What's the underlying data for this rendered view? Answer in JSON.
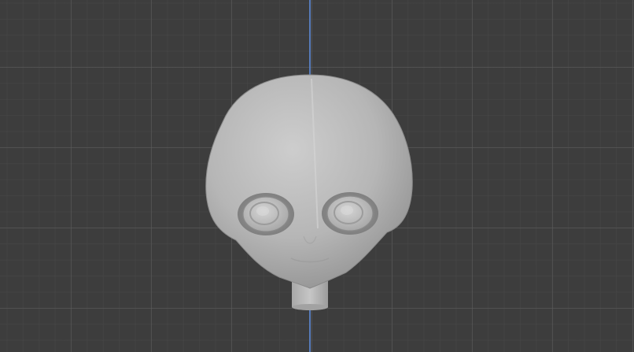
{
  "viewport": {
    "background_color": "#3d3d3d",
    "grid_minor_color": "#484848",
    "grid_major_color": "#5c5c5c",
    "z_axis_color": "#5a82c8"
  },
  "object": {
    "icon": "sculpt-head-mesh",
    "material_color": "#bdbdbd"
  }
}
